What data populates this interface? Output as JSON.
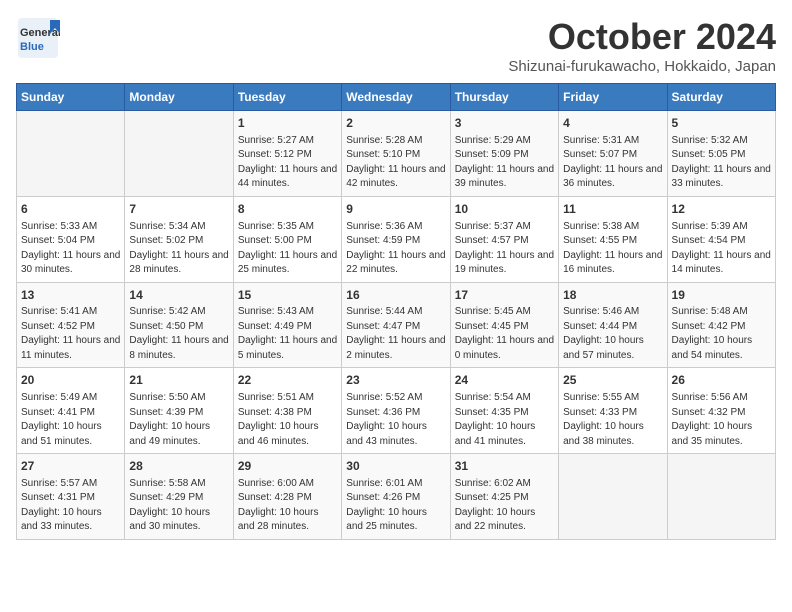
{
  "header": {
    "logo_general": "General",
    "logo_blue": "Blue",
    "month_title": "October 2024",
    "subtitle": "Shizunai-furukawacho, Hokkaido, Japan"
  },
  "weekdays": [
    "Sunday",
    "Monday",
    "Tuesday",
    "Wednesday",
    "Thursday",
    "Friday",
    "Saturday"
  ],
  "weeks": [
    [
      {
        "day": "",
        "content": ""
      },
      {
        "day": "",
        "content": ""
      },
      {
        "day": "1",
        "content": "Sunrise: 5:27 AM\nSunset: 5:12 PM\nDaylight: 11 hours and 44 minutes."
      },
      {
        "day": "2",
        "content": "Sunrise: 5:28 AM\nSunset: 5:10 PM\nDaylight: 11 hours and 42 minutes."
      },
      {
        "day": "3",
        "content": "Sunrise: 5:29 AM\nSunset: 5:09 PM\nDaylight: 11 hours and 39 minutes."
      },
      {
        "day": "4",
        "content": "Sunrise: 5:31 AM\nSunset: 5:07 PM\nDaylight: 11 hours and 36 minutes."
      },
      {
        "day": "5",
        "content": "Sunrise: 5:32 AM\nSunset: 5:05 PM\nDaylight: 11 hours and 33 minutes."
      }
    ],
    [
      {
        "day": "6",
        "content": "Sunrise: 5:33 AM\nSunset: 5:04 PM\nDaylight: 11 hours and 30 minutes."
      },
      {
        "day": "7",
        "content": "Sunrise: 5:34 AM\nSunset: 5:02 PM\nDaylight: 11 hours and 28 minutes."
      },
      {
        "day": "8",
        "content": "Sunrise: 5:35 AM\nSunset: 5:00 PM\nDaylight: 11 hours and 25 minutes."
      },
      {
        "day": "9",
        "content": "Sunrise: 5:36 AM\nSunset: 4:59 PM\nDaylight: 11 hours and 22 minutes."
      },
      {
        "day": "10",
        "content": "Sunrise: 5:37 AM\nSunset: 4:57 PM\nDaylight: 11 hours and 19 minutes."
      },
      {
        "day": "11",
        "content": "Sunrise: 5:38 AM\nSunset: 4:55 PM\nDaylight: 11 hours and 16 minutes."
      },
      {
        "day": "12",
        "content": "Sunrise: 5:39 AM\nSunset: 4:54 PM\nDaylight: 11 hours and 14 minutes."
      }
    ],
    [
      {
        "day": "13",
        "content": "Sunrise: 5:41 AM\nSunset: 4:52 PM\nDaylight: 11 hours and 11 minutes."
      },
      {
        "day": "14",
        "content": "Sunrise: 5:42 AM\nSunset: 4:50 PM\nDaylight: 11 hours and 8 minutes."
      },
      {
        "day": "15",
        "content": "Sunrise: 5:43 AM\nSunset: 4:49 PM\nDaylight: 11 hours and 5 minutes."
      },
      {
        "day": "16",
        "content": "Sunrise: 5:44 AM\nSunset: 4:47 PM\nDaylight: 11 hours and 2 minutes."
      },
      {
        "day": "17",
        "content": "Sunrise: 5:45 AM\nSunset: 4:45 PM\nDaylight: 11 hours and 0 minutes."
      },
      {
        "day": "18",
        "content": "Sunrise: 5:46 AM\nSunset: 4:44 PM\nDaylight: 10 hours and 57 minutes."
      },
      {
        "day": "19",
        "content": "Sunrise: 5:48 AM\nSunset: 4:42 PM\nDaylight: 10 hours and 54 minutes."
      }
    ],
    [
      {
        "day": "20",
        "content": "Sunrise: 5:49 AM\nSunset: 4:41 PM\nDaylight: 10 hours and 51 minutes."
      },
      {
        "day": "21",
        "content": "Sunrise: 5:50 AM\nSunset: 4:39 PM\nDaylight: 10 hours and 49 minutes."
      },
      {
        "day": "22",
        "content": "Sunrise: 5:51 AM\nSunset: 4:38 PM\nDaylight: 10 hours and 46 minutes."
      },
      {
        "day": "23",
        "content": "Sunrise: 5:52 AM\nSunset: 4:36 PM\nDaylight: 10 hours and 43 minutes."
      },
      {
        "day": "24",
        "content": "Sunrise: 5:54 AM\nSunset: 4:35 PM\nDaylight: 10 hours and 41 minutes."
      },
      {
        "day": "25",
        "content": "Sunrise: 5:55 AM\nSunset: 4:33 PM\nDaylight: 10 hours and 38 minutes."
      },
      {
        "day": "26",
        "content": "Sunrise: 5:56 AM\nSunset: 4:32 PM\nDaylight: 10 hours and 35 minutes."
      }
    ],
    [
      {
        "day": "27",
        "content": "Sunrise: 5:57 AM\nSunset: 4:31 PM\nDaylight: 10 hours and 33 minutes."
      },
      {
        "day": "28",
        "content": "Sunrise: 5:58 AM\nSunset: 4:29 PM\nDaylight: 10 hours and 30 minutes."
      },
      {
        "day": "29",
        "content": "Sunrise: 6:00 AM\nSunset: 4:28 PM\nDaylight: 10 hours and 28 minutes."
      },
      {
        "day": "30",
        "content": "Sunrise: 6:01 AM\nSunset: 4:26 PM\nDaylight: 10 hours and 25 minutes."
      },
      {
        "day": "31",
        "content": "Sunrise: 6:02 AM\nSunset: 4:25 PM\nDaylight: 10 hours and 22 minutes."
      },
      {
        "day": "",
        "content": ""
      },
      {
        "day": "",
        "content": ""
      }
    ]
  ]
}
